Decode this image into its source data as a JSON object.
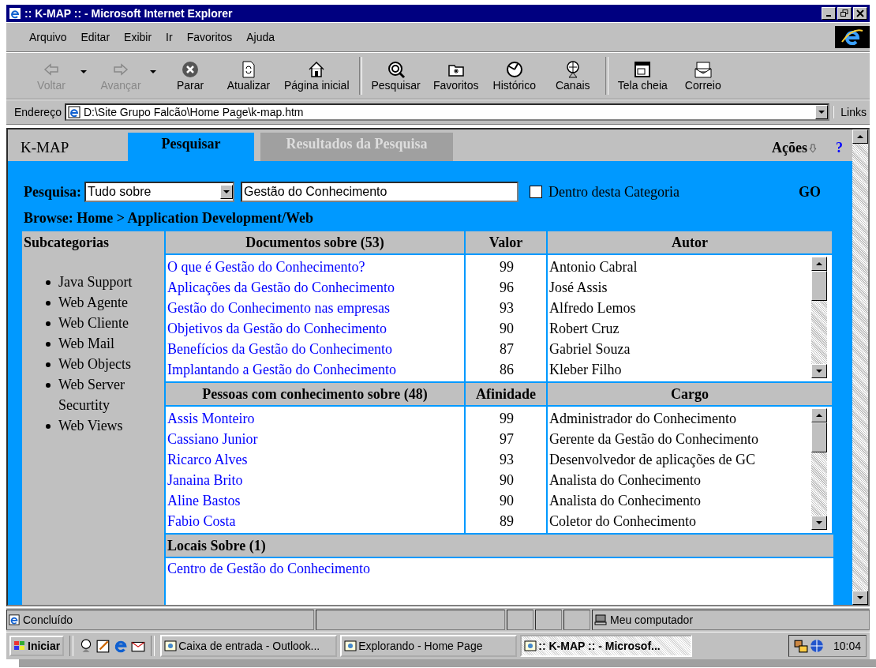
{
  "window": {
    "title": ":: K-MAP :: - Microsoft Internet Explorer"
  },
  "menu": [
    "Arquivo",
    "Editar",
    "Exibir",
    "Ir",
    "Favoritos",
    "Ajuda"
  ],
  "toolbar": [
    {
      "kind": "back",
      "label": "Voltar",
      "disabled": true,
      "dropdown": true
    },
    {
      "kind": "forward",
      "label": "Avançar",
      "disabled": true,
      "dropdown": true
    },
    {
      "kind": "stop",
      "label": "Parar",
      "disabled": false,
      "dropdown": false
    },
    {
      "kind": "refresh",
      "label": "Atualizar",
      "disabled": false,
      "dropdown": false
    },
    {
      "kind": "home",
      "label": "Página inicial",
      "disabled": false,
      "dropdown": false
    },
    {
      "kind": "search",
      "label": "Pesquisar",
      "disabled": false,
      "dropdown": false
    },
    {
      "kind": "favorites",
      "label": "Favoritos",
      "disabled": false,
      "dropdown": false
    },
    {
      "kind": "history",
      "label": "Histórico",
      "disabled": false,
      "dropdown": false
    },
    {
      "kind": "channels",
      "label": "Canais",
      "disabled": false,
      "dropdown": false
    },
    {
      "kind": "fullscreen",
      "label": "Tela cheia",
      "disabled": false,
      "dropdown": false
    },
    {
      "kind": "mail",
      "label": "Correio",
      "disabled": false,
      "dropdown": false
    }
  ],
  "address": {
    "label": "Endereço",
    "value": "D:\\Site Grupo Falcão\\Home Page\\k-map.htm",
    "links": "Links"
  },
  "page": {
    "logo": "K-MAP",
    "tabs": [
      {
        "label": "Pesquisar",
        "selected": true
      },
      {
        "label": "Resultados da Pesquisa",
        "selected": false
      }
    ],
    "actions": "Ações",
    "help": "?",
    "search": {
      "label": "Pesquisa:",
      "scope": "Tudo sobre",
      "query": "Gestão do Conhecimento",
      "within_label": "Dentro desta Categoria",
      "within_checked": false,
      "go": "GO"
    },
    "breadcrumb": "Browse: Home > Application Development/Web",
    "subcategories": {
      "title": "Subcategorias",
      "items": [
        "Java Support",
        "Web Agente",
        "Web Cliente",
        "Web Mail",
        "Web Objects",
        "Web Server Securtity",
        "Web Views"
      ]
    },
    "documents": {
      "columns": [
        "Documentos sobre (53)",
        "Valor",
        "Autor"
      ],
      "rows": [
        {
          "title": "O que é Gestão do Conhecimento?",
          "score": "99",
          "who": "Antonio Cabral"
        },
        {
          "title": "Aplicações da Gestão do Conhecimento",
          "score": "96",
          "who": "José Assis"
        },
        {
          "title": "Gestão do Conhecimento nas empresas",
          "score": "93",
          "who": "Alfredo Lemos"
        },
        {
          "title": "Objetivos da Gestão do Conhecimento",
          "score": "90",
          "who": "Robert Cruz"
        },
        {
          "title": "Benefícios da Gestão do Conhecimento",
          "score": "87",
          "who": "Gabriel Souza"
        },
        {
          "title": "Implantando a Gestão do Conhecimento",
          "score": "86",
          "who": "Kleber Filho"
        }
      ]
    },
    "people": {
      "columns": [
        "Pessoas com conhecimento sobre (48)",
        "Afinidade",
        "Cargo"
      ],
      "rows": [
        {
          "title": "Assis Monteiro",
          "score": "99",
          "who": "Administrador do Conhecimento"
        },
        {
          "title": "Cassiano Junior",
          "score": "97",
          "who": "Gerente da Gestão do Conhecimento"
        },
        {
          "title": "Ricarco Alves",
          "score": "93",
          "who": "Desenvolvedor de aplicações de GC"
        },
        {
          "title": "Janaina Brito",
          "score": "90",
          "who": "Analista do Conhecimento"
        },
        {
          "title": "Aline Bastos",
          "score": "90",
          "who": "Analista do Conhecimento"
        },
        {
          "title": "Fabio Costa",
          "score": "89",
          "who": "Coletor do Conhecimento"
        }
      ]
    },
    "places": {
      "title": "Locais Sobre (1)",
      "rows": [
        "Centro de Gestão do Conhecimento"
      ]
    }
  },
  "status": {
    "text": "Concluído",
    "zone": "Meu computador"
  },
  "taskbar": {
    "start": "Iniciar",
    "tasks": [
      {
        "label": "Caixa de entrada - Outlook...",
        "selected": false
      },
      {
        "label": "Explorando - Home Page",
        "selected": false
      },
      {
        "label": ":: K-MAP :: - Microsof...",
        "selected": true
      }
    ],
    "clock": "10:04"
  }
}
